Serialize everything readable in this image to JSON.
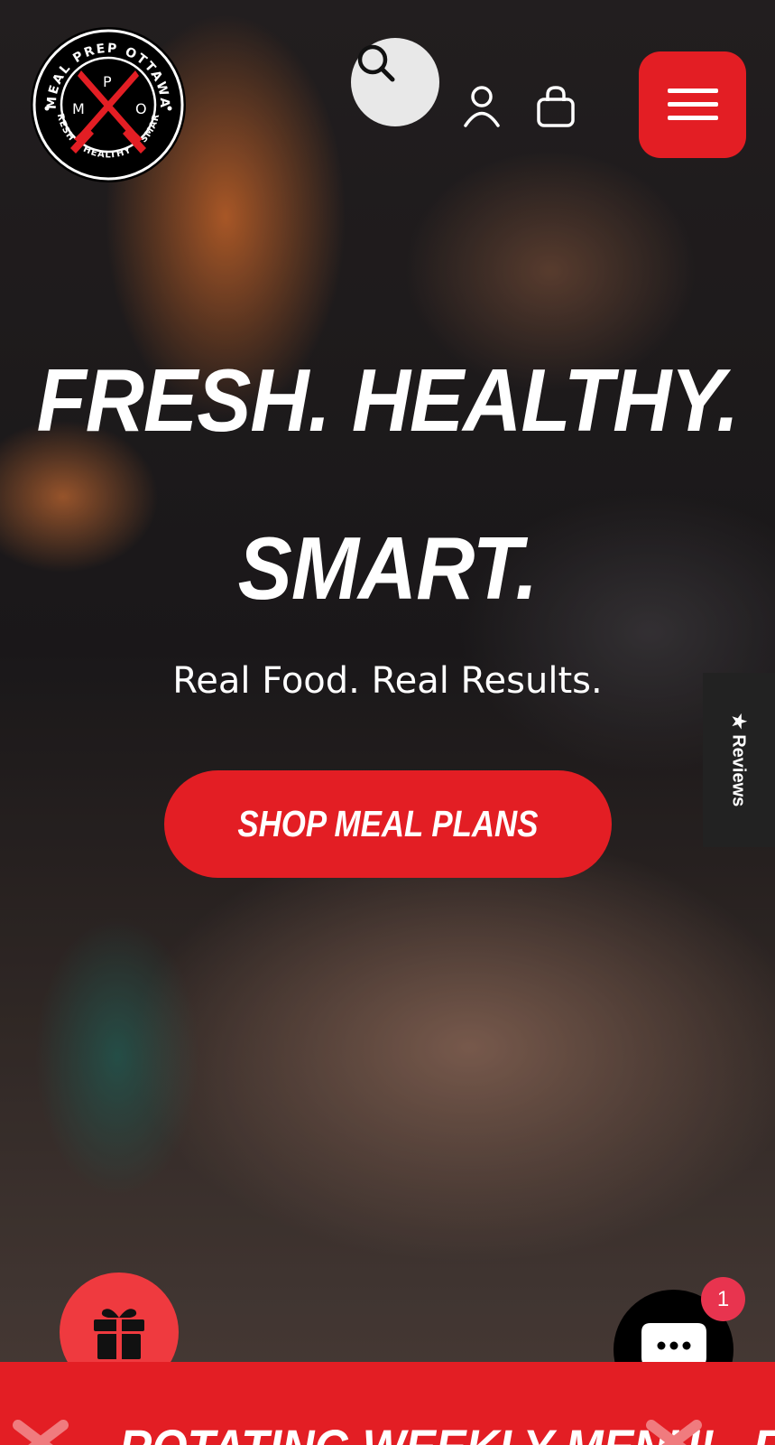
{
  "header": {
    "logo": {
      "top_text": "MEAL PREP OTTAWA",
      "bottom_text": "FRESH • HEALTHY • SMART",
      "left_letter": "M",
      "center_letter": "P",
      "right_letter": "O",
      "icon": "crossed-knives-icon",
      "accent": "#e31e24"
    },
    "search_icon": "search-icon",
    "account_icon": "user-icon",
    "cart_icon": "shopping-bag-icon",
    "menu_icon": "hamburger-icon"
  },
  "hero": {
    "title_line1": "FRESH. HEALTHY.",
    "title_line2": "SMART.",
    "subtitle": "Real Food. Real Results.",
    "cta_label": "SHOP MEAL PLANS"
  },
  "reviews_tab": {
    "label": "★ Reviews"
  },
  "floating": {
    "gift_icon": "gift-icon",
    "chat_icon": "chat-bubble-icon",
    "chat_badge": "1"
  },
  "ticker": {
    "text": "ROTATING WEEKLY MENU!",
    "next_text": "R"
  },
  "colors": {
    "brand_red": "#e31e24",
    "search_circle": "#e8e8e8",
    "reviews_tab_bg": "#222222",
    "badge": "#e8344f"
  }
}
